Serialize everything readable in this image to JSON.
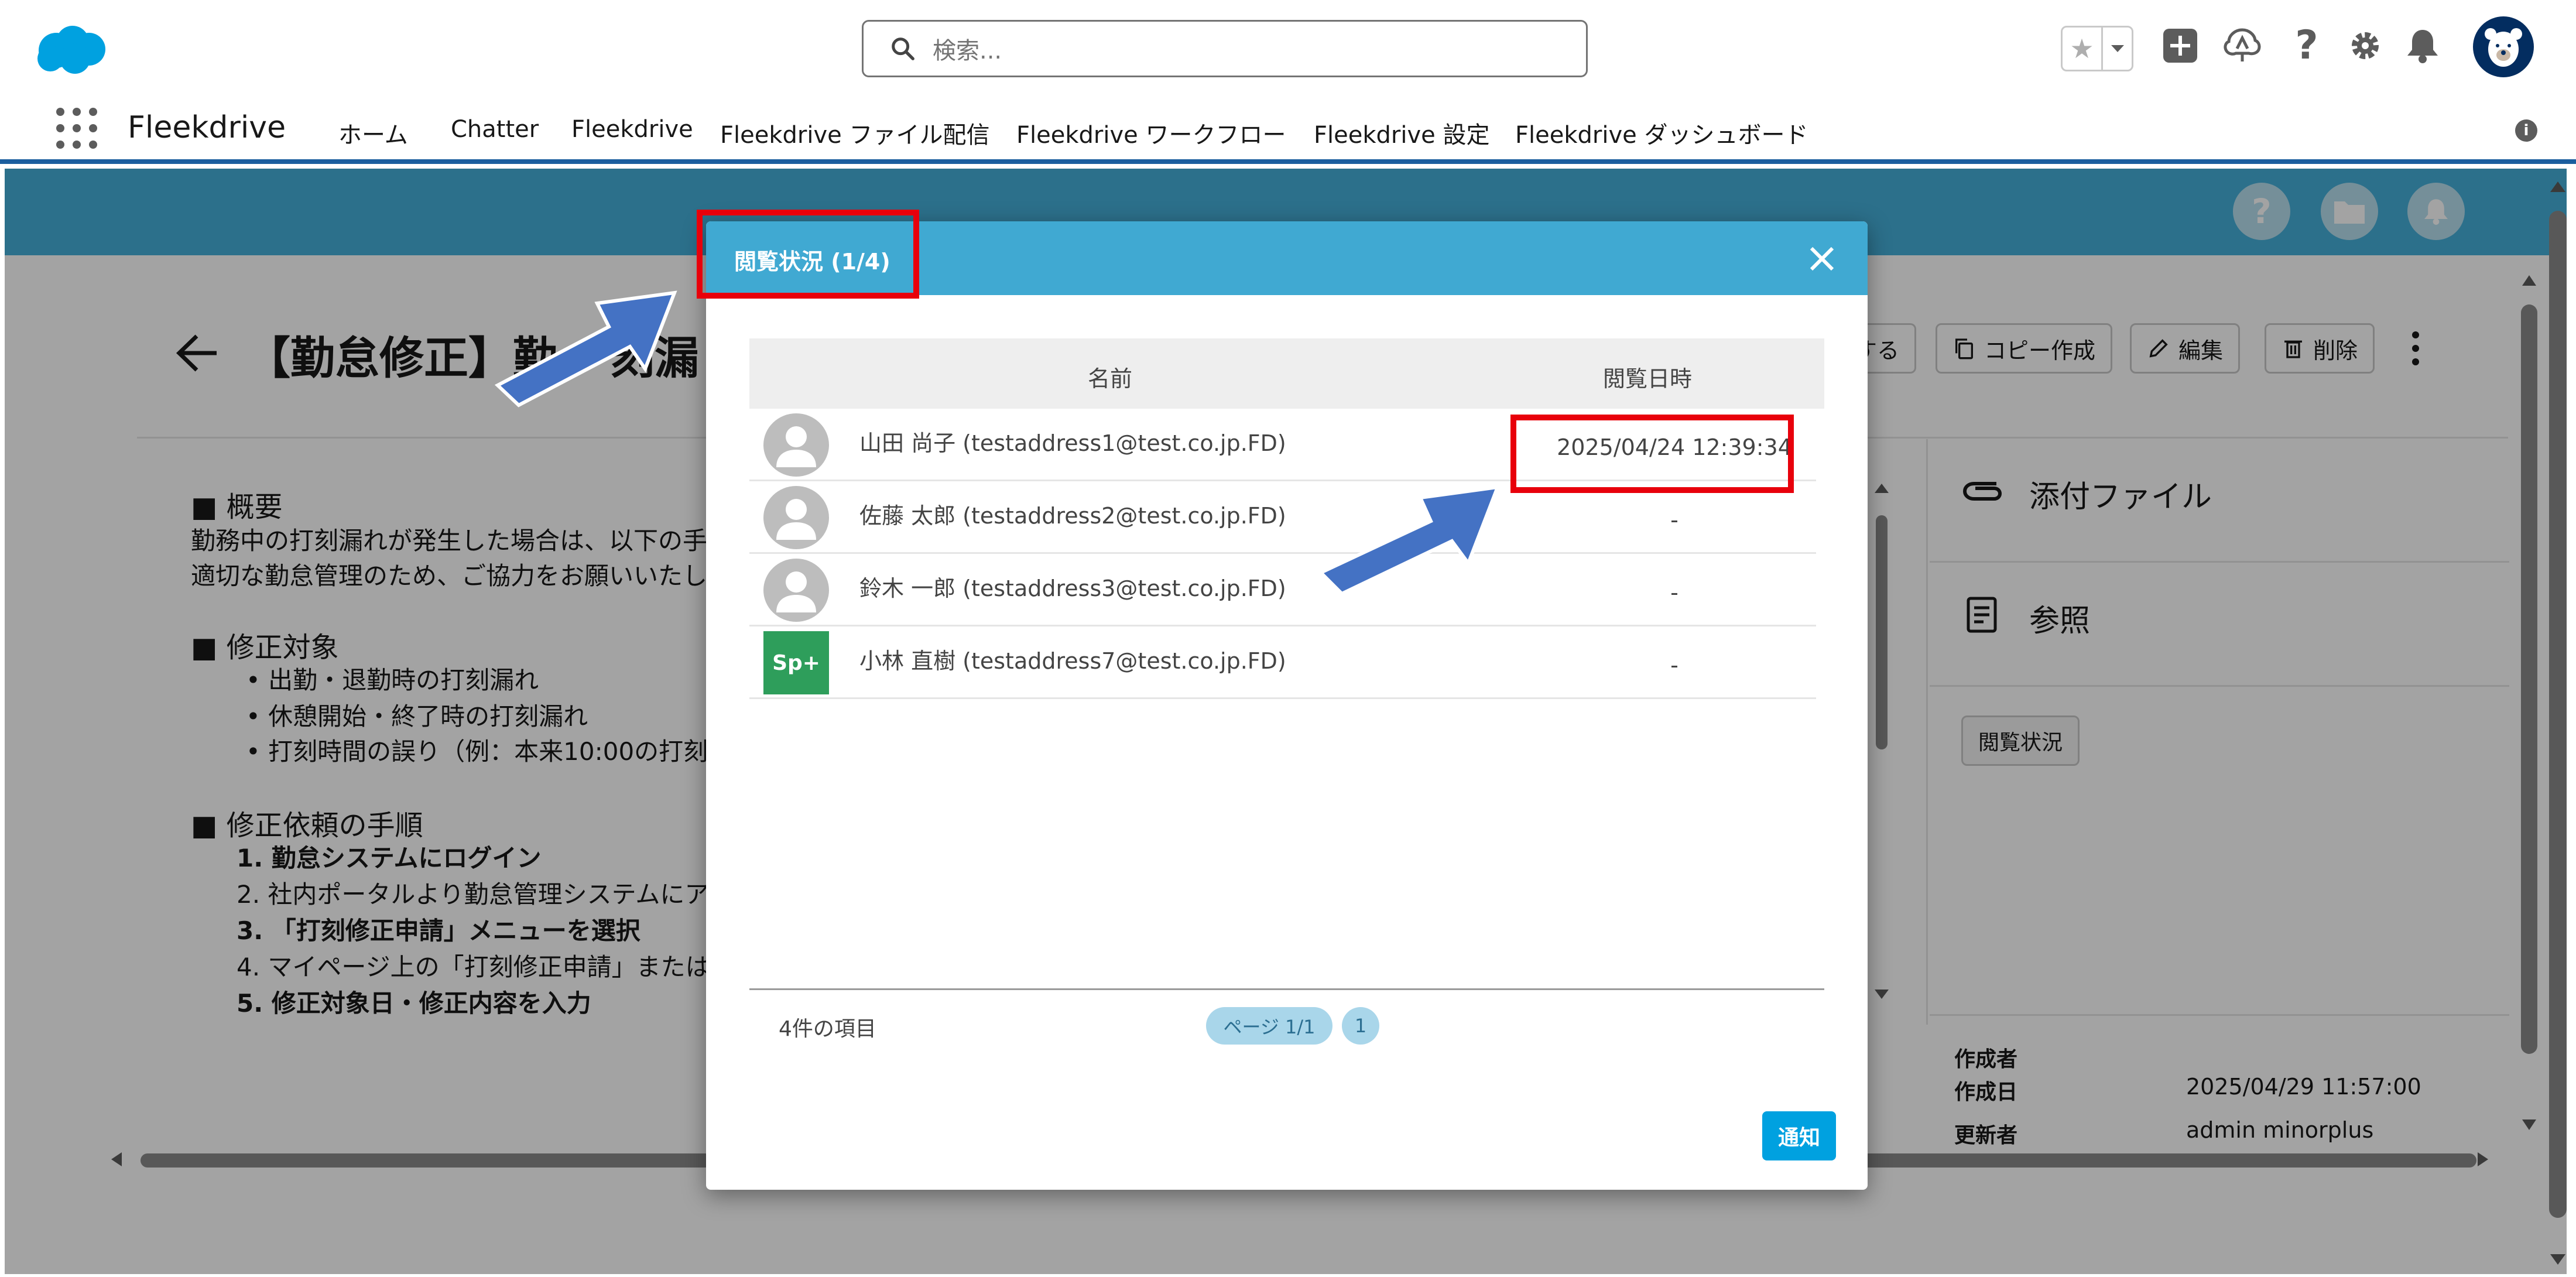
{
  "header": {
    "search_placeholder": "検索...",
    "colors": {
      "brand": "#00a1e0",
      "nav_accent": "#1b5e9e",
      "band": "#46b0d9",
      "modal_header": "#40a9d2",
      "annotation_red": "#e8000b",
      "annotation_arrow": "#4472c4"
    },
    "icons": [
      "salesforce-cloud-icon",
      "search-icon",
      "star-icon",
      "chevron-down-icon",
      "add-icon",
      "trailhead-icon",
      "help-icon",
      "gear-icon",
      "bell-icon",
      "user-avatar-icon"
    ]
  },
  "nav": {
    "app_name": "Fleekdrive",
    "items": [
      {
        "label": "ホーム"
      },
      {
        "label": "Chatter"
      },
      {
        "label": "Fleekdrive"
      },
      {
        "label": "Fleekdrive ファイル配信"
      },
      {
        "label": "Fleekdrive ワークフロー"
      },
      {
        "label": "Fleekdrive 設定"
      },
      {
        "label": "Fleekdrive ダッシュボード"
      }
    ]
  },
  "record": {
    "title": "【勤怠修正】勤",
    "title_suffix": "刻漏",
    "actions": {
      "partial": "する",
      "copy": "コピー作成",
      "edit": "編集",
      "delete": "削除"
    },
    "body": {
      "h1": "■ 概要",
      "p1": "勤務中の打刻漏れが発生した場合は、以下の手",
      "p2": "適切な勤怠管理のため、ご協力をお願いいたし",
      "h2": "■ 修正対象",
      "b1": "• 出勤・退勤時の打刻漏れ",
      "b2": "• 休憩開始・終了時の打刻漏れ",
      "b3": "• 打刻時間の誤り（例：本来10:00の打刻",
      "h3": "■ 修正依頼の手順",
      "s1": "1. 勤怠システムにログイン",
      "s2": "2. 社内ポータルより勤怠管理システムにア",
      "s3": "3. 「打刻修正申請」メニューを選択",
      "s4": "4. マイページ上の「打刻修正申請」または",
      "s5": "5. 修正対象日・修正内容を入力"
    },
    "side": {
      "attachments": "添付ファイル",
      "reference": "参照",
      "view_status_btn": "閲覧状況",
      "created_by_label": "作成者",
      "created_date_label": "作成日",
      "created_date_value": "2025/04/29 11:57:00",
      "updated_by_label": "更新者",
      "updated_by_value": "admin minorplus"
    }
  },
  "modal": {
    "title": "閲覧状況 (1/4)",
    "columns": {
      "name": "名前",
      "viewed_at": "閲覧日時"
    },
    "rows": [
      {
        "avatar": "person-avatar-icon",
        "name": "山田 尚子 (testaddress1@test.co.jp.FD)",
        "viewed_at": "2025/04/24 12:39:34"
      },
      {
        "avatar": "person-avatar-icon",
        "name": "佐藤 太郎 (testaddress2@test.co.jp.FD)",
        "viewed_at": "-"
      },
      {
        "avatar": "person-avatar-icon",
        "name": "鈴木 一郎 (testaddress3@test.co.jp.FD)",
        "viewed_at": "-"
      },
      {
        "avatar": "Sp+",
        "name": "小林 直樹 (testaddress7@test.co.jp.FD)",
        "viewed_at": "-"
      }
    ],
    "item_count": "4件の項目",
    "pager": {
      "page": "ページ 1/1",
      "current": "1"
    },
    "notify_button": "通知"
  }
}
